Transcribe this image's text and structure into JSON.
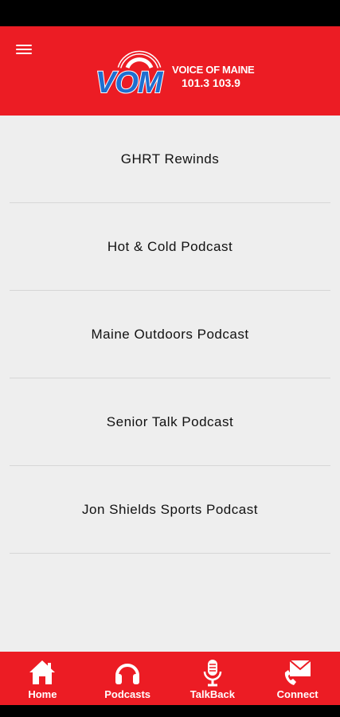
{
  "header": {
    "logo": {
      "brand": "VOM",
      "tagline": "VOICE OF MAINE",
      "frequencies": "101.3 103.9"
    },
    "menu_icon": "hamburger-menu-icon"
  },
  "podcasts": [
    {
      "label": "GHRT Rewinds"
    },
    {
      "label": "Hot & Cold Podcast"
    },
    {
      "label": "Maine Outdoors Podcast"
    },
    {
      "label": "Senior Talk Podcast"
    },
    {
      "label": "Jon Shields Sports Podcast"
    }
  ],
  "tabs": [
    {
      "label": "Home",
      "icon": "home-icon"
    },
    {
      "label": "Podcasts",
      "icon": "headphones-icon"
    },
    {
      "label": "TalkBack",
      "icon": "microphone-icon"
    },
    {
      "label": "Connect",
      "icon": "envelope-phone-icon"
    }
  ],
  "colors": {
    "brand_red": "#ec1c24",
    "logo_blue": "#1e6fd0",
    "list_background": "#eeeeee"
  }
}
